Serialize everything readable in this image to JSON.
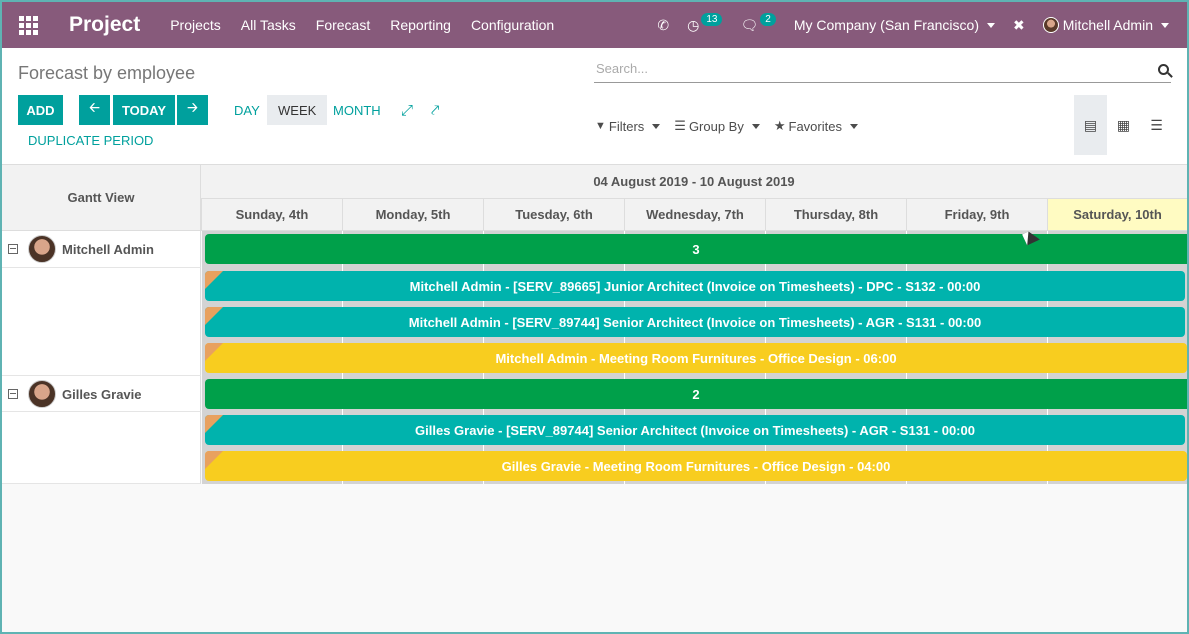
{
  "navbar": {
    "brand": "Project",
    "menu": [
      "Projects",
      "All Tasks",
      "Forecast",
      "Reporting",
      "Configuration"
    ],
    "activity_count": "13",
    "message_count": "2",
    "company": "My Company (San Francisco)",
    "user": "Mitchell Admin"
  },
  "control": {
    "breadcrumb": "Forecast by employee",
    "add_label": "ADD",
    "today_label": "TODAY",
    "duplicate_label": "DUPLICATE PERIOD",
    "scales": [
      "DAY",
      "WEEK",
      "MONTH"
    ],
    "active_scale": "WEEK",
    "search_placeholder": "Search...",
    "filters_label": "Filters",
    "groupby_label": "Group By",
    "favorites_label": "Favorites"
  },
  "gantt": {
    "title": "Gantt View",
    "range": "04 August 2019 - 10 August 2019",
    "days": [
      "Sunday, 4th",
      "Monday, 5th",
      "Tuesday, 6th",
      "Wednesday, 7th",
      "Thursday, 8th",
      "Friday, 9th",
      "Saturday, 10th"
    ],
    "today_index": 6,
    "groups": [
      {
        "name": "Mitchell Admin",
        "count": "3",
        "tasks": [
          {
            "label": "Mitchell Admin - [SERV_89665] Junior Architect (Invoice on Timesheets) - DPC - S132 - 00:00",
            "color": "#00b3ad"
          },
          {
            "label": "Mitchell Admin - [SERV_89744] Senior Architect (Invoice on Timesheets) - AGR - S131 - 00:00",
            "color": "#00b3ad"
          },
          {
            "label": "Mitchell Admin - Meeting Room Furnitures - Office Design - 06:00",
            "color": "#f8cd1f"
          }
        ]
      },
      {
        "name": "Gilles Gravie",
        "count": "2",
        "tasks": [
          {
            "label": "Gilles Gravie - [SERV_89744] Senior Architect (Invoice on Timesheets) - AGR - S131 - 00:00",
            "color": "#00b3ad"
          },
          {
            "label": "Gilles Gravie - Meeting Room Furnitures - Office Design - 04:00",
            "color": "#f8cd1f"
          }
        ]
      }
    ]
  }
}
